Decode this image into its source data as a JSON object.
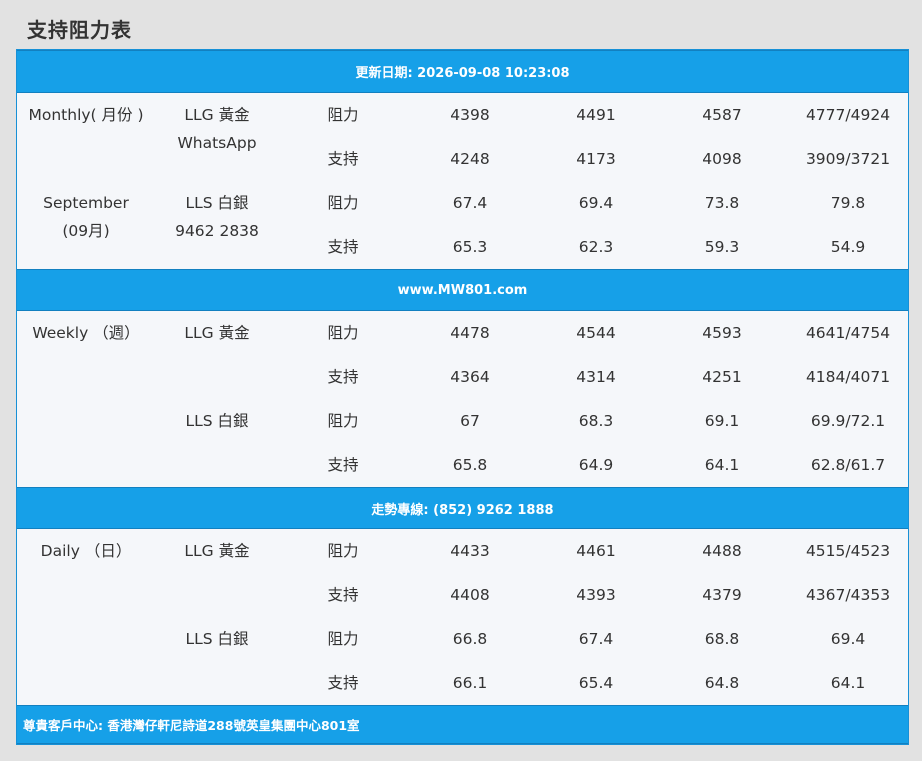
{
  "title": "支持阻力表",
  "bands": {
    "date": "更新日期: 2026-09-08 10:23:08",
    "site": "www.MW801.com",
    "hotline": "走勢專線: (852) 9262 1888",
    "address": "尊貴客戶中心: 香港灣仔軒尼詩道288號英皇集團中心801室"
  },
  "monthly": {
    "period": "Monthly( 月份 )",
    "month": "September",
    "month_cn": "(09月)",
    "whatsapp_label": "WhatsApp",
    "phone": "9462 2838",
    "gold": {
      "name": "LLG 黃金",
      "res_label": "阻力",
      "res": [
        "4398",
        "4491",
        "4587",
        "4777/4924"
      ],
      "sup_label": "支持",
      "sup": [
        "4248",
        "4173",
        "4098",
        "3909/3721"
      ]
    },
    "silver": {
      "name": "LLS 白銀",
      "res_label": "阻力",
      "res": [
        "67.4",
        "69.4",
        "73.8",
        "79.8"
      ],
      "sup_label": "支持",
      "sup": [
        "65.3",
        "62.3",
        "59.3",
        "54.9"
      ]
    }
  },
  "weekly": {
    "period": "Weekly （週）",
    "gold": {
      "name": "LLG 黃金",
      "res_label": "阻力",
      "res": [
        "4478",
        "4544",
        "4593",
        "4641/4754"
      ],
      "sup_label": "支持",
      "sup": [
        "4364",
        "4314",
        "4251",
        "4184/4071"
      ]
    },
    "silver": {
      "name": "LLS 白銀",
      "res_label": "阻力",
      "res": [
        "67",
        "68.3",
        "69.1",
        "69.9/72.1"
      ],
      "sup_label": "支持",
      "sup": [
        "65.8",
        "64.9",
        "64.1",
        "62.8/61.7"
      ]
    }
  },
  "daily": {
    "period": "Daily （日）",
    "gold": {
      "name": "LLG 黃金",
      "res_label": "阻力",
      "res": [
        "4433",
        "4461",
        "4488",
        "4515/4523"
      ],
      "sup_label": "支持",
      "sup": [
        "4408",
        "4393",
        "4379",
        "4367/4353"
      ]
    },
    "silver": {
      "name": "LLS 白銀",
      "res_label": "阻力",
      "res": [
        "66.8",
        "67.4",
        "68.8",
        "69.4"
      ],
      "sup_label": "支持",
      "sup": [
        "66.1",
        "65.4",
        "64.8",
        "64.1"
      ]
    }
  }
}
